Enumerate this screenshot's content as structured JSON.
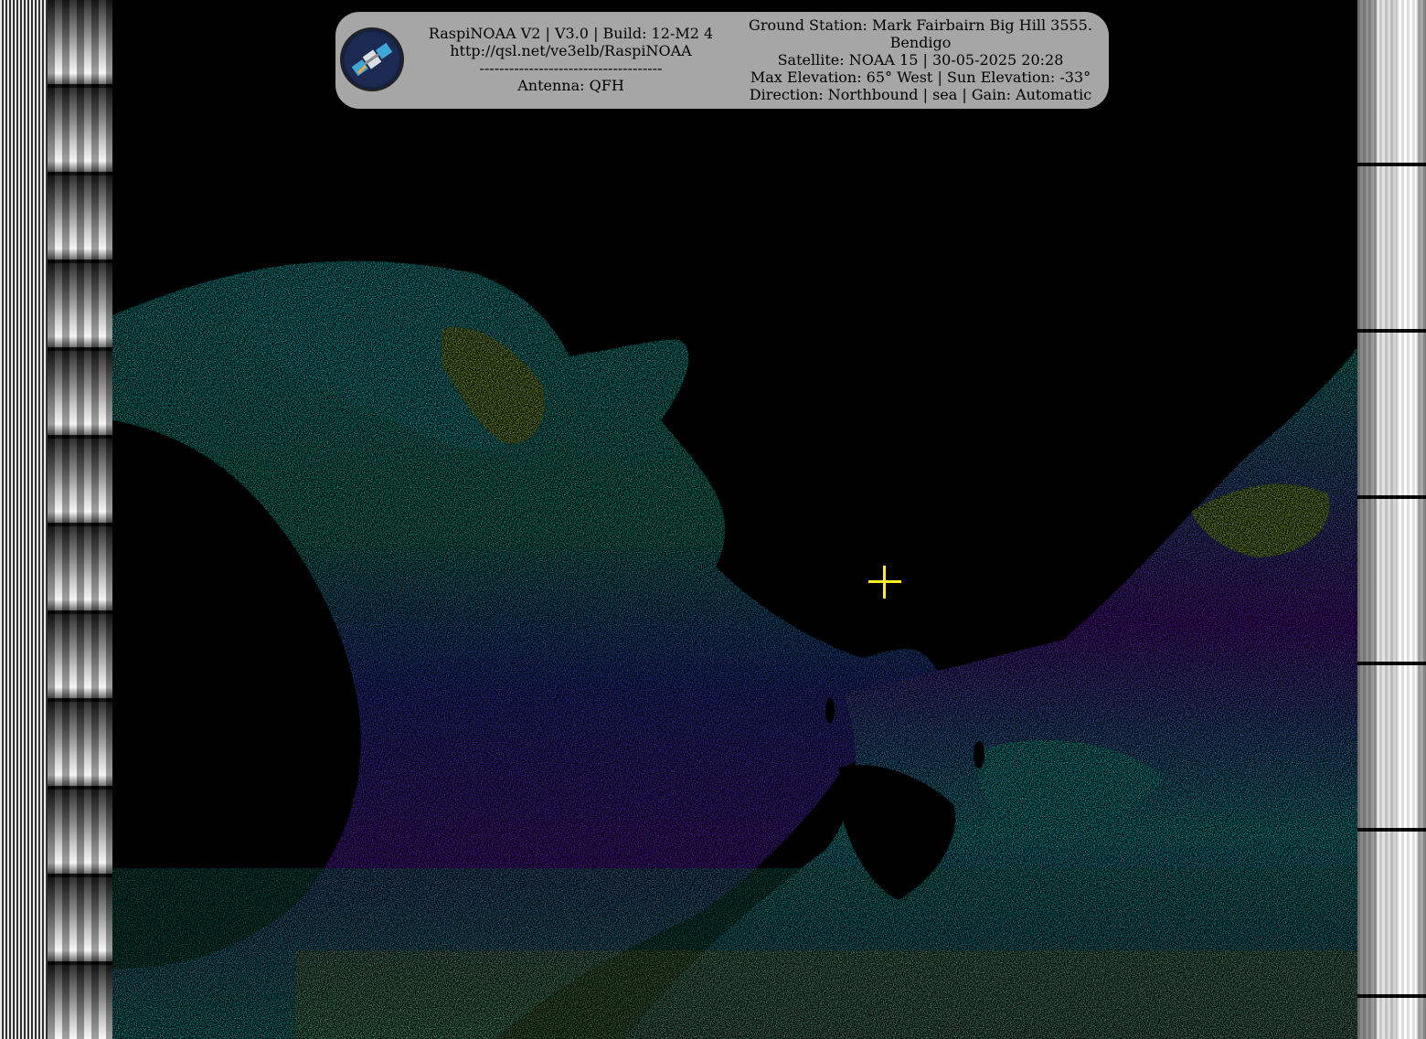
{
  "info_box": {
    "software_line": "RaspiNOAA V2 | V3.0 | Build: 12-M2 4",
    "url": "http://qsl.net/ve3elb/RaspiNOAA",
    "divider": "-------------------------------------",
    "antenna": "Antenna: QFH",
    "ground_station": "Ground Station: Mark Fairbairn Big Hill 3555.",
    "ground_station_city": "Bendigo",
    "satellite": "Satellite: NOAA 15 | 30-05-2025 20:28",
    "elevation": "Max Elevation: 65° West | Sun Elevation: -33°",
    "direction": "Direction: Northbound | sea | Gain: Automatic"
  },
  "logo": {
    "icon": "satellite-icon"
  },
  "marker": {
    "icon": "crosshair-icon",
    "color": "#ffef1a"
  },
  "palette": {
    "background": "#000000",
    "purple": "#7a1fe6",
    "blue": "#3a4be8",
    "cyan": "#19e0e0",
    "teal": "#1fc9a8",
    "green": "#a6e04a",
    "yellow": "#e8e03a"
  }
}
